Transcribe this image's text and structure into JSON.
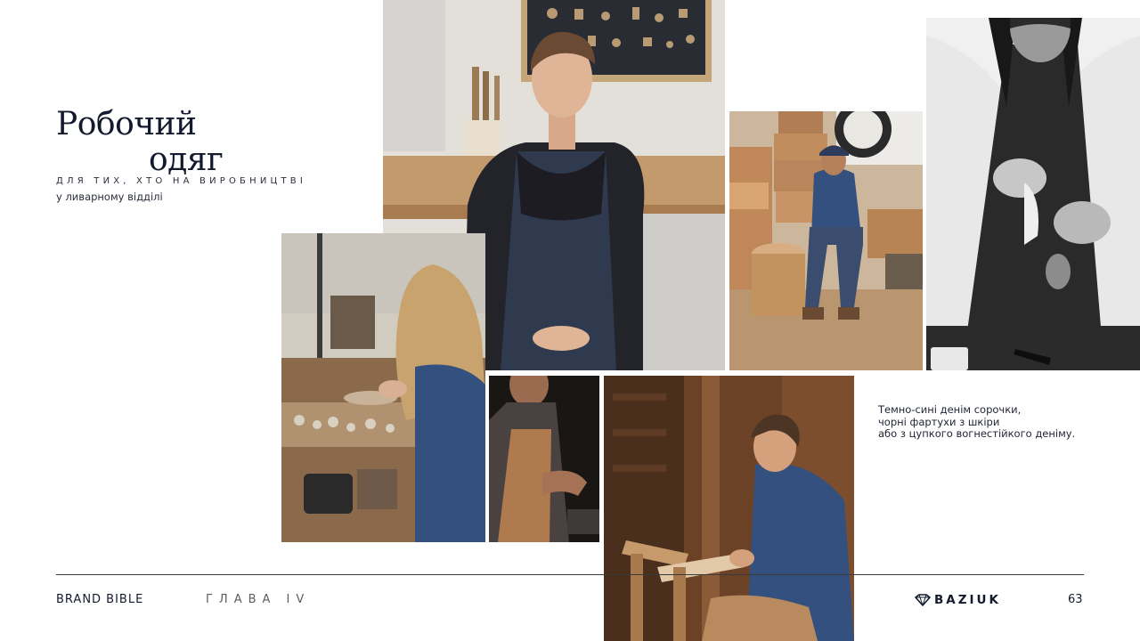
{
  "heading": {
    "line1": "Робочий",
    "line2": "одяг",
    "caps_subtitle": "ДЛЯ ТИХ, ХТО НА ВИРОБНИЦТВІ",
    "small_subtitle": "у ливарному відділі"
  },
  "description": {
    "line1": "Темно-сині денім сорочки,",
    "line2": "чорні фартухи з шкіри",
    "line3": "або з цупкого вогнестійкого деніму."
  },
  "footer": {
    "brand": "BRAND BIBLE",
    "chapter": "ГЛАВА IV",
    "logo_text": "BAZIUK",
    "page_number": "63"
  },
  "colors": {
    "text_dark": "#141a2e",
    "rule": "#3a3a3a",
    "apron_denim": "#2f3a4e",
    "shirt_blue": "#34507e",
    "wood": "#b98a5e"
  }
}
